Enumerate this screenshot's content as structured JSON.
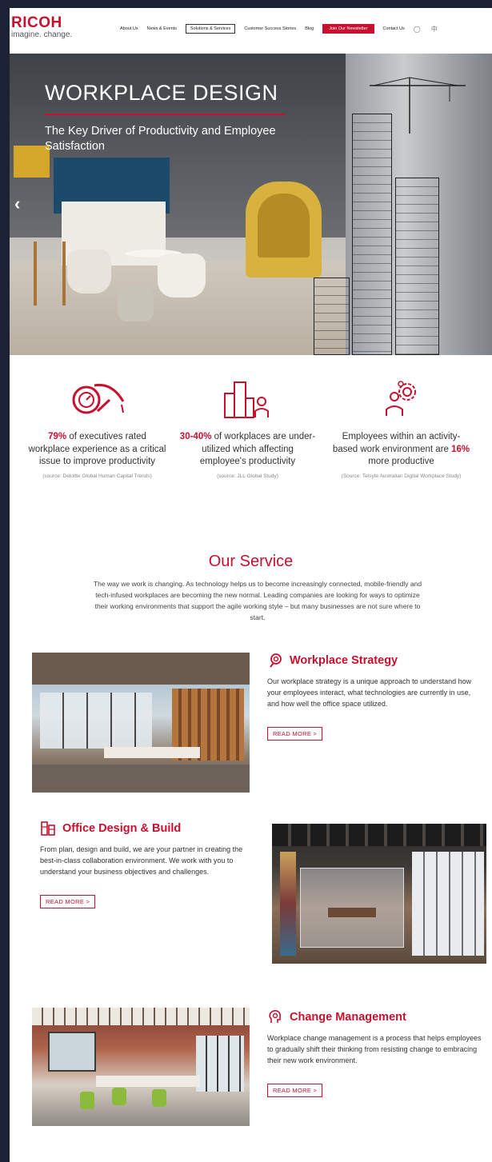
{
  "header": {
    "logo": "RICOH",
    "tagline": "imagine. change.",
    "nav": [
      "About Us",
      "News & Events",
      "Solutions & Services",
      "Customer Success Stories",
      "Blog",
      "Join Our Newsletter",
      "Contact Us"
    ],
    "language": "中"
  },
  "hero": {
    "title": "WORKPLACE DESIGN",
    "subtitle": "The Key Driver of Productivity and Employee Satisfaction",
    "prev_arrow": "‹"
  },
  "stats": [
    {
      "highlight": "79%",
      "text_before": "",
      "text_after": " of executives rated workplace experience as a critical issue to improve productivity",
      "source": "(source: Deloitte Global Human Capital Trends)",
      "icon": "speedometer-icon"
    },
    {
      "highlight": "30-40%",
      "text_before": "",
      "text_after": " of workplaces are under-utilized which affecting employee's productivity",
      "source": "(source: JLL Global Study)",
      "icon": "building-person-icon"
    },
    {
      "highlight": "16%",
      "text_before": "Employees within an activity-based work environment are ",
      "text_after": " more productive",
      "source": "(Source: Telsyte Australian Digital Workplace Study)",
      "icon": "gear-people-icon"
    }
  ],
  "service": {
    "title": "Our Service",
    "intro": "The way we work is changing. As technology helps us to become increasingly connected, mobile-friendly and tech-infused workplaces are becoming the new normal. Leading companies are looking for ways to optimize their working environments that support the agile working style – but many businesses are not sure where to start.",
    "sections": [
      {
        "title": "Workplace Strategy",
        "body": "Our workplace strategy is a unique approach to understand how your employees interact, what technologies are currently in use, and how well the office space utilized.",
        "cta": "READ MORE >"
      },
      {
        "title": "Office Design & Build",
        "body": "From plan, design and build, we are your partner in creating the best-in-class collaboration environment. We work with you to understand your business objectives and challenges.",
        "cta": "READ MORE >"
      },
      {
        "title": "Change Management",
        "body": "Workplace change management is a process that helps employees to gradually shift their thinking from resisting change to embracing their new work environment.",
        "cta": "READ MORE >"
      }
    ]
  },
  "colors": {
    "brand": "#c8102e",
    "frame": "#1c2233"
  }
}
